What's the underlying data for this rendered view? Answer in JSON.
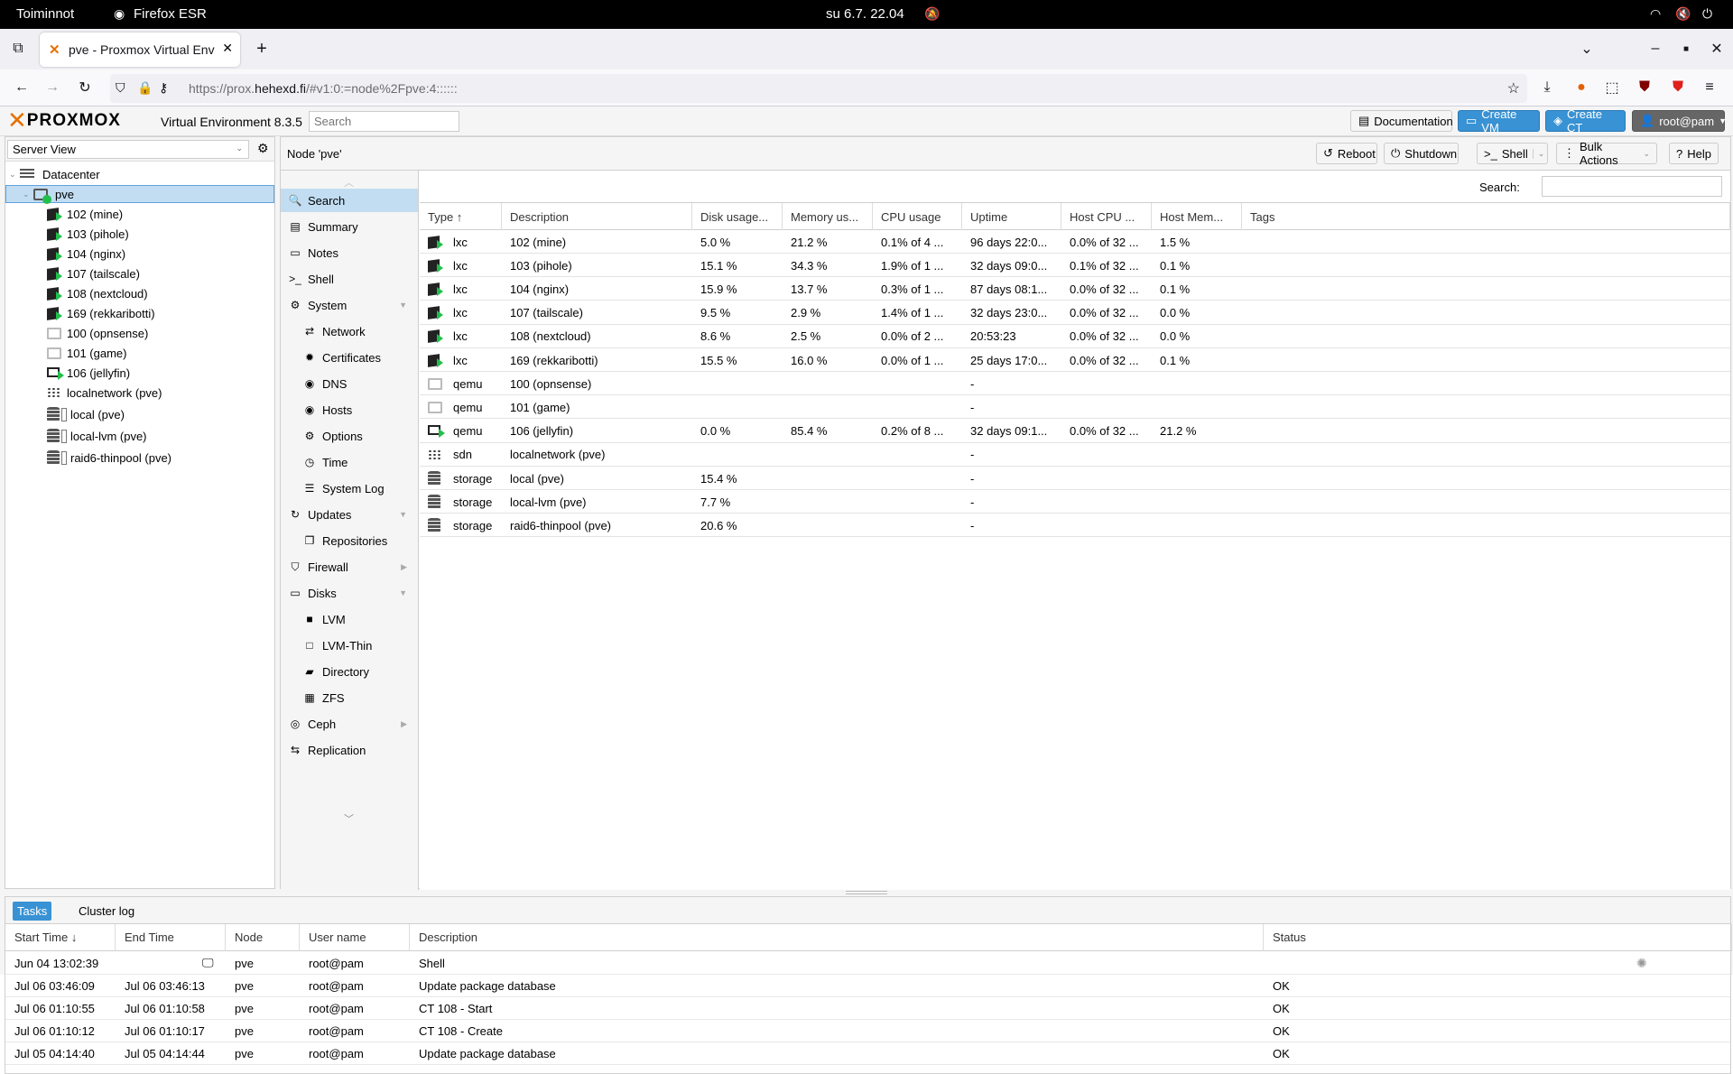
{
  "system": {
    "activities": "Toiminnot",
    "app": "Firefox ESR",
    "clock": "su 6.7.  22.04"
  },
  "browser": {
    "tab_title": "pve - Proxmox Virtual Env",
    "url_prefix": "https://prox.",
    "url_host": "hehexd.fi",
    "url_path": "/#v1:0:=node%2Fpve:4::::::"
  },
  "pve": {
    "logo": "PROXMOX",
    "version": "Virtual Environment 8.3.5",
    "search_placeholder": "Search",
    "buttons": {
      "docs": "Documentation",
      "create_vm": "Create VM",
      "create_ct": "Create CT",
      "user": "root@pam"
    }
  },
  "tree": {
    "view": "Server View",
    "datacenter": "Datacenter",
    "node": "pve",
    "items": [
      {
        "label": "102 (mine)",
        "kind": "lxc"
      },
      {
        "label": "103 (pihole)",
        "kind": "lxc"
      },
      {
        "label": "104 (nginx)",
        "kind": "lxc"
      },
      {
        "label": "107 (tailscale)",
        "kind": "lxc"
      },
      {
        "label": "108 (nextcloud)",
        "kind": "lxc"
      },
      {
        "label": "169 (rekkaribotti)",
        "kind": "lxc"
      },
      {
        "label": "100 (opnsense)",
        "kind": "qemu-off"
      },
      {
        "label": "101 (game)",
        "kind": "qemu-off"
      },
      {
        "label": "106 (jellyfin)",
        "kind": "qemu-on"
      },
      {
        "label": "localnetwork (pve)",
        "kind": "sdn"
      },
      {
        "label": "local (pve)",
        "kind": "storage"
      },
      {
        "label": "local-lvm (pve)",
        "kind": "storage"
      },
      {
        "label": "raid6-thinpool (pve)",
        "kind": "storage"
      }
    ]
  },
  "node": {
    "title": "Node 'pve'",
    "buttons": {
      "reboot": "Reboot",
      "shutdown": "Shutdown",
      "shell": "Shell",
      "bulk": "Bulk Actions",
      "help": "Help"
    },
    "search_label": "Search:"
  },
  "menu": [
    {
      "label": "Search",
      "icon": "search-icon",
      "glyph": "🔍",
      "indent": false,
      "selected": true
    },
    {
      "label": "Summary",
      "icon": "book-icon",
      "glyph": "▤",
      "indent": false
    },
    {
      "label": "Notes",
      "icon": "notes-icon",
      "glyph": "▭",
      "indent": false
    },
    {
      "label": "Shell",
      "icon": "terminal-icon",
      "glyph": ">_",
      "indent": false
    },
    {
      "label": "System",
      "icon": "cogs-icon",
      "glyph": "⚙",
      "indent": false,
      "expander": "down"
    },
    {
      "label": "Network",
      "icon": "exchange-icon",
      "glyph": "⇄",
      "indent": true
    },
    {
      "label": "Certificates",
      "icon": "certificate-icon",
      "glyph": "✹",
      "indent": true
    },
    {
      "label": "DNS",
      "icon": "globe-icon",
      "glyph": "◉",
      "indent": true
    },
    {
      "label": "Hosts",
      "icon": "globe-icon",
      "glyph": "◉",
      "indent": true
    },
    {
      "label": "Options",
      "icon": "gear-icon",
      "glyph": "⚙",
      "indent": true
    },
    {
      "label": "Time",
      "icon": "clock-icon",
      "glyph": "◷",
      "indent": true
    },
    {
      "label": "System Log",
      "icon": "list-icon",
      "glyph": "☰",
      "indent": true
    },
    {
      "label": "Updates",
      "icon": "refresh-icon",
      "glyph": "↻",
      "indent": false,
      "expander": "down"
    },
    {
      "label": "Repositories",
      "icon": "files-icon",
      "glyph": "❐",
      "indent": true
    },
    {
      "label": "Firewall",
      "icon": "shield-icon",
      "glyph": "⛉",
      "indent": false,
      "expander": "right"
    },
    {
      "label": "Disks",
      "icon": "hdd-icon",
      "glyph": "▭",
      "indent": false,
      "expander": "down"
    },
    {
      "label": "LVM",
      "icon": "square-icon",
      "glyph": "■",
      "indent": true
    },
    {
      "label": "LVM-Thin",
      "icon": "square-outline-icon",
      "glyph": "□",
      "indent": true
    },
    {
      "label": "Directory",
      "icon": "folder-icon",
      "glyph": "▰",
      "indent": true
    },
    {
      "label": "ZFS",
      "icon": "th-large-icon",
      "glyph": "▦",
      "indent": true
    },
    {
      "label": "Ceph",
      "icon": "ceph-icon",
      "glyph": "◎",
      "indent": false,
      "expander": "right"
    },
    {
      "label": "Replication",
      "icon": "retweet-icon",
      "glyph": "⇆",
      "indent": false
    }
  ],
  "grid": {
    "columns": [
      "Type ↑",
      "Description",
      "Disk usage...",
      "Memory us...",
      "CPU usage",
      "Uptime",
      "Host CPU ...",
      "Host Mem...",
      "Tags"
    ],
    "rows": [
      {
        "type": "lxc",
        "kind": "lxc",
        "desc": "102 (mine)",
        "disk": "5.0 %",
        "mem": "21.2 %",
        "cpu": "0.1% of 4 ...",
        "uptime": "96 days 22:0...",
        "hcpu": "0.0% of 32 ...",
        "hmem": "1.5 %"
      },
      {
        "type": "lxc",
        "kind": "lxc",
        "desc": "103 (pihole)",
        "disk": "15.1 %",
        "mem": "34.3 %",
        "cpu": "1.9% of 1 ...",
        "uptime": "32 days 09:0...",
        "hcpu": "0.1% of 32 ...",
        "hmem": "0.1 %"
      },
      {
        "type": "lxc",
        "kind": "lxc",
        "desc": "104 (nginx)",
        "disk": "15.9 %",
        "mem": "13.7 %",
        "cpu": "0.3% of 1 ...",
        "uptime": "87 days 08:1...",
        "hcpu": "0.0% of 32 ...",
        "hmem": "0.1 %"
      },
      {
        "type": "lxc",
        "kind": "lxc",
        "desc": "107 (tailscale)",
        "disk": "9.5 %",
        "mem": "2.9 %",
        "cpu": "1.4% of 1 ...",
        "uptime": "32 days 23:0...",
        "hcpu": "0.0% of 32 ...",
        "hmem": "0.0 %"
      },
      {
        "type": "lxc",
        "kind": "lxc",
        "desc": "108 (nextcloud)",
        "disk": "8.6 %",
        "mem": "2.5 %",
        "cpu": "0.0% of 2 ...",
        "uptime": "20:53:23",
        "hcpu": "0.0% of 32 ...",
        "hmem": "0.0 %"
      },
      {
        "type": "lxc",
        "kind": "lxc",
        "desc": "169 (rekkaribotti)",
        "disk": "15.5 %",
        "mem": "16.0 %",
        "cpu": "0.0% of 1 ...",
        "uptime": "25 days 17:0...",
        "hcpu": "0.0% of 32 ...",
        "hmem": "0.1 %"
      },
      {
        "type": "qemu",
        "kind": "qemu-off",
        "desc": "100 (opnsense)",
        "disk": "",
        "mem": "",
        "cpu": "",
        "uptime": "-",
        "hcpu": "",
        "hmem": ""
      },
      {
        "type": "qemu",
        "kind": "qemu-off",
        "desc": "101 (game)",
        "disk": "",
        "mem": "",
        "cpu": "",
        "uptime": "-",
        "hcpu": "",
        "hmem": ""
      },
      {
        "type": "qemu",
        "kind": "qemu-on",
        "desc": "106 (jellyfin)",
        "disk": "0.0 %",
        "mem": "85.4 %",
        "cpu": "0.2% of 8 ...",
        "uptime": "32 days 09:1...",
        "hcpu": "0.0% of 32 ...",
        "hmem": "21.2 %"
      },
      {
        "type": "sdn",
        "kind": "sdn",
        "desc": "localnetwork (pve)",
        "disk": "",
        "mem": "",
        "cpu": "",
        "uptime": "-",
        "hcpu": "",
        "hmem": ""
      },
      {
        "type": "storage",
        "kind": "storage",
        "desc": "local (pve)",
        "disk": "15.4 %",
        "mem": "",
        "cpu": "",
        "uptime": "-",
        "hcpu": "",
        "hmem": ""
      },
      {
        "type": "storage",
        "kind": "storage",
        "desc": "local-lvm (pve)",
        "disk": "7.7 %",
        "mem": "",
        "cpu": "",
        "uptime": "-",
        "hcpu": "",
        "hmem": ""
      },
      {
        "type": "storage",
        "kind": "storage",
        "desc": "raid6-thinpool (pve)",
        "disk": "20.6 %",
        "mem": "",
        "cpu": "",
        "uptime": "-",
        "hcpu": "",
        "hmem": ""
      }
    ]
  },
  "tasks": {
    "tabs": [
      "Tasks",
      "Cluster log"
    ],
    "columns": [
      "Start Time ↓",
      "End Time",
      "Node",
      "User name",
      "Description",
      "Status"
    ],
    "rows": [
      {
        "start": "Jun 04 13:02:39",
        "end": "",
        "node": "pve",
        "user": "root@pam",
        "desc": "Shell",
        "status": "",
        "running": true
      },
      {
        "start": "Jul 06 03:46:09",
        "end": "Jul 06 03:46:13",
        "node": "pve",
        "user": "root@pam",
        "desc": "Update package database",
        "status": "OK"
      },
      {
        "start": "Jul 06 01:10:55",
        "end": "Jul 06 01:10:58",
        "node": "pve",
        "user": "root@pam",
        "desc": "CT 108 - Start",
        "status": "OK"
      },
      {
        "start": "Jul 06 01:10:12",
        "end": "Jul 06 01:10:17",
        "node": "pve",
        "user": "root@pam",
        "desc": "CT 108 - Create",
        "status": "OK"
      },
      {
        "start": "Jul 05 04:14:40",
        "end": "Jul 05 04:14:44",
        "node": "pve",
        "user": "root@pam",
        "desc": "Update package database",
        "status": "OK"
      }
    ]
  }
}
